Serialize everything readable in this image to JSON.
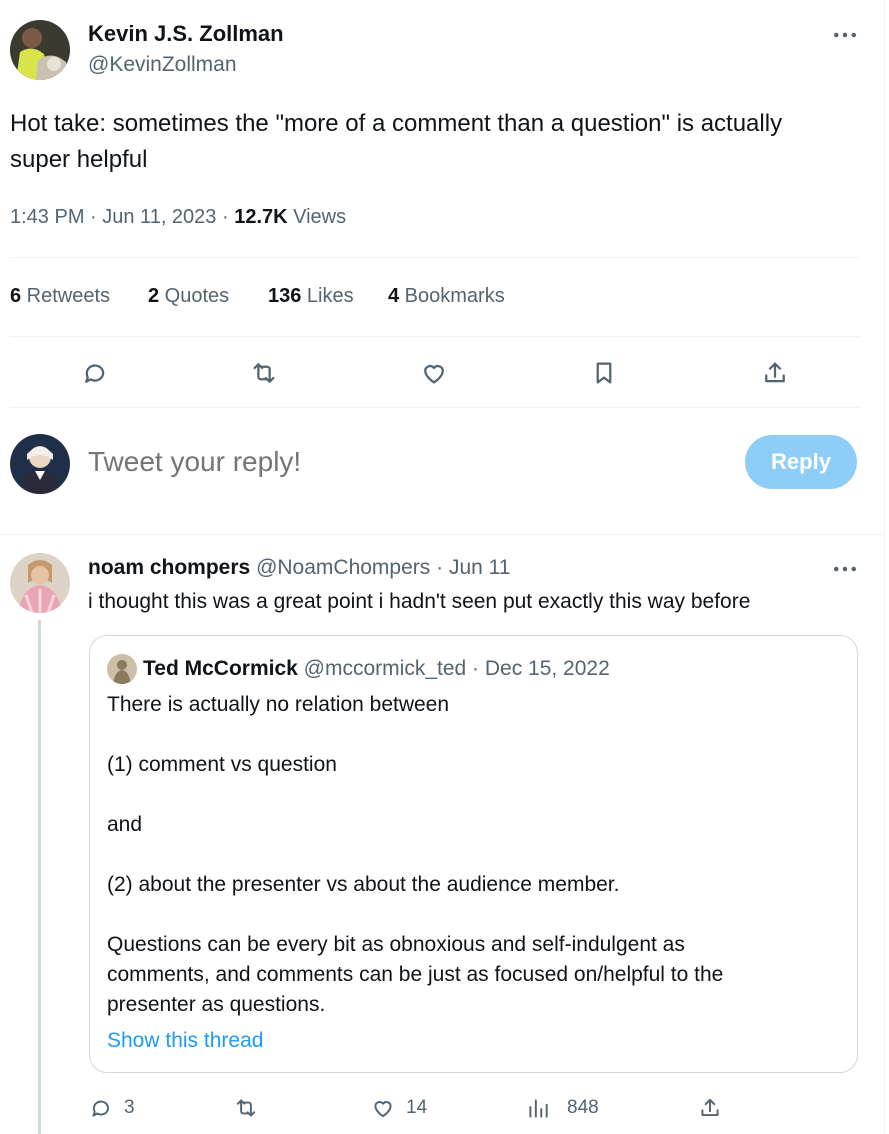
{
  "tweet": {
    "author_name": "Kevin J.S. Zollman",
    "author_handle": "@KevinZollman",
    "text_line1": "Hot take: sometimes the \"more of a comment than a question\" is actually",
    "text_line2": "super helpful",
    "time": "1:43 PM · Jun 11, 2023 · ",
    "views_count": "12.7K",
    "views_label": " Views",
    "more_icon": "more-horizontal-icon"
  },
  "stats": {
    "retweets_count": "6",
    "retweets_label": " Retweets",
    "quotes_count": "2",
    "quotes_label": " Quotes",
    "likes_count": "136",
    "likes_label": " Likes",
    "bookmarks_count": "4",
    "bookmarks_label": " Bookmarks"
  },
  "actions": [
    "reply-icon",
    "retweet-icon",
    "like-icon",
    "bookmark-icon",
    "share-icon"
  ],
  "composer": {
    "placeholder": "Tweet your reply!",
    "reply_label": "Reply",
    "reply_button_color": "#8ecdf8"
  },
  "reply": {
    "author_name": "noam chompers",
    "author_handle": "@NoamChompers",
    "date": " · Jun 11",
    "text": "i thought this was a great point i hadn't seen put exactly this way before",
    "quoted": {
      "author_name": "Ted McCormick",
      "author_handle": "@mccormick_ted",
      "date": " · Dec 15, 2022",
      "lines": [
        "There is actually no relation between",
        "(1) comment vs question",
        "and",
        "(2) about the presenter vs about the audience member.",
        "Questions can be every bit as obnoxious and self-indulgent as",
        "comments, and comments can be just as focused on/helpful to the",
        "presenter as questions."
      ],
      "show_thread": "Show this thread"
    },
    "reply_count": "3",
    "retweet_count": "",
    "like_count": "14",
    "views_count": "848"
  },
  "colors": {
    "link": "#1d9bf0",
    "muted": "#536471",
    "text": "#0f1419",
    "divider": "#eff3f4"
  }
}
